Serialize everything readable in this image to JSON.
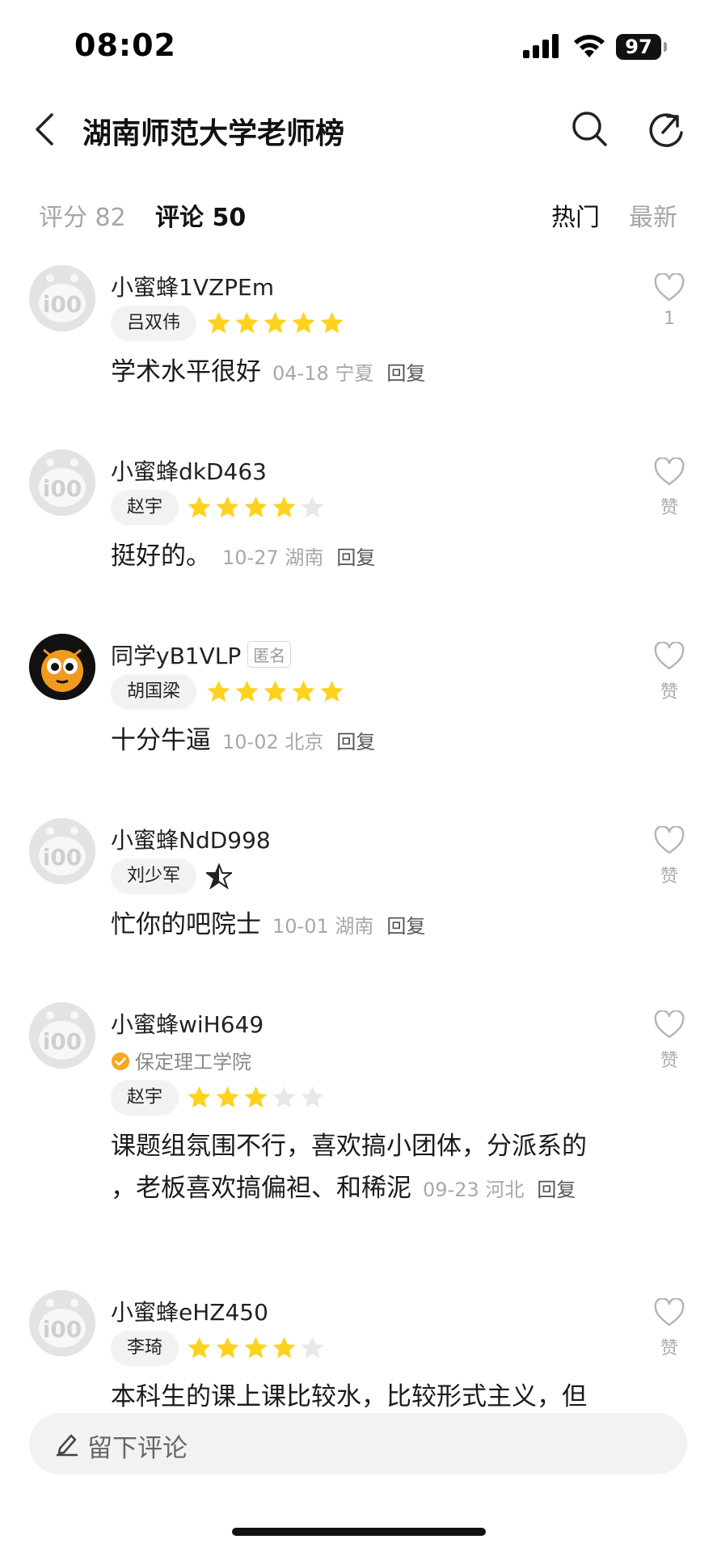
{
  "status_bar": {
    "time": "08:02",
    "battery": "97"
  },
  "header": {
    "title": "湖南师范大学老师榜"
  },
  "tabs": {
    "score": "评分 82",
    "comments": "评论 50",
    "hot": "热门",
    "newest": "最新"
  },
  "colors": {
    "star_filled": "#FFD21F",
    "star_empty": "#E8E8E8",
    "verified": "#F5A623",
    "avatar_gray": "#E3E3E3"
  },
  "comments": [
    {
      "user": "小蜜蜂1VZPEm",
      "teacher": "吕双伟",
      "rating": 5,
      "text": "学术水平很好",
      "meta": "04-18 宁夏",
      "reply": "回复",
      "like": "1"
    },
    {
      "user": "小蜜蜂dkD463",
      "teacher": "赵宇",
      "rating": 4,
      "text": "挺好的。",
      "meta": "10-27 湖南",
      "reply": "回复",
      "like": "赞"
    },
    {
      "user": "同学yB1VLP",
      "anon": "匿名",
      "teacher": "胡国梁",
      "rating": 5,
      "text": "十分牛逼",
      "meta": "10-02 北京",
      "reply": "回复",
      "like": "赞"
    },
    {
      "user": "小蜜蜂NdD998",
      "teacher": "刘少军",
      "rating": 0.5,
      "text": "忙你的吧院士",
      "meta": "10-01 湖南",
      "reply": "回复",
      "like": "赞"
    },
    {
      "user": "小蜜蜂wiH649",
      "school": "保定理工学院",
      "teacher": "赵宇",
      "rating": 3,
      "text_line1": "课题组氛围不行，喜欢搞小团体，分派系的",
      "text_line2": "，老板喜欢搞偏袒、和稀泥",
      "meta": "09-23 河北",
      "reply": "回复",
      "like": "赞"
    },
    {
      "user": "小蜜蜂eHZ450",
      "teacher": "李琦",
      "rating": 4,
      "text": "本科生的课上课比较水，比较形式主义，但",
      "like": "赞"
    }
  ],
  "input": {
    "placeholder": "留下评论"
  }
}
